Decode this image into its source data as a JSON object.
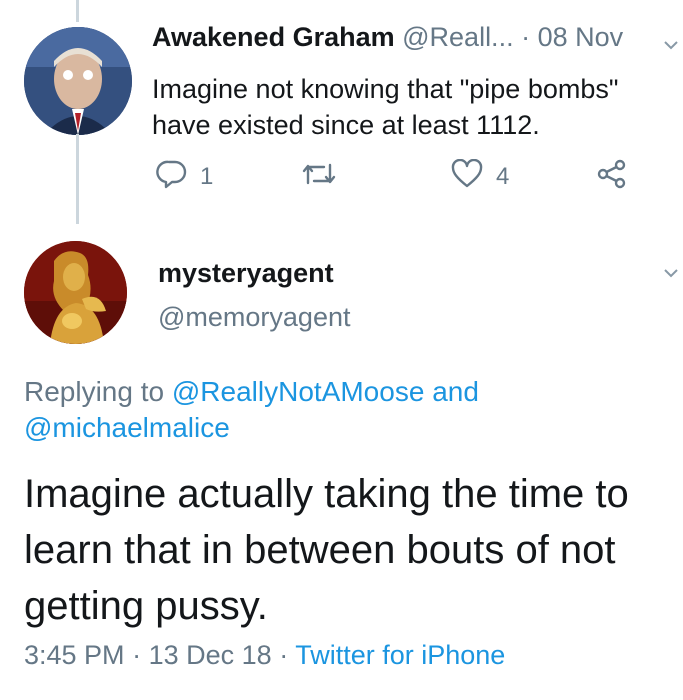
{
  "parent_tweet": {
    "display_name": "Awakened Graham",
    "handle": "@Reall...",
    "date": "· 08 Nov",
    "text": "Imagine not knowing that \"pipe bombs\" have existed since at least 1112.",
    "reply_count": "1",
    "retweet_count": "",
    "like_count": "4"
  },
  "main_tweet": {
    "display_name": "mysteryagent",
    "handle": "@memoryagent",
    "replying_prefix": "Replying to",
    "replying_user_1": "@ReallyNotAMoose",
    "replying_and": "and",
    "replying_user_2": "@michaelmalice",
    "text_line_1": "Imagine actually taking the time to",
    "text_line_2": "learn that in between bouts of not",
    "text_line_3": "getting pussy.",
    "time": "3:45 PM",
    "separator": "·",
    "date": "13 Dec 18",
    "source": "Twitter for iPhone"
  },
  "icons": {
    "reply": "reply-icon",
    "retweet": "retweet-icon",
    "like": "heart-icon",
    "share": "share-icon",
    "caret": "chevron-down-icon"
  },
  "colors": {
    "link": "#1b95e0",
    "muted": "#657786",
    "text": "#14171a",
    "thread_line": "#ccd6dd"
  }
}
